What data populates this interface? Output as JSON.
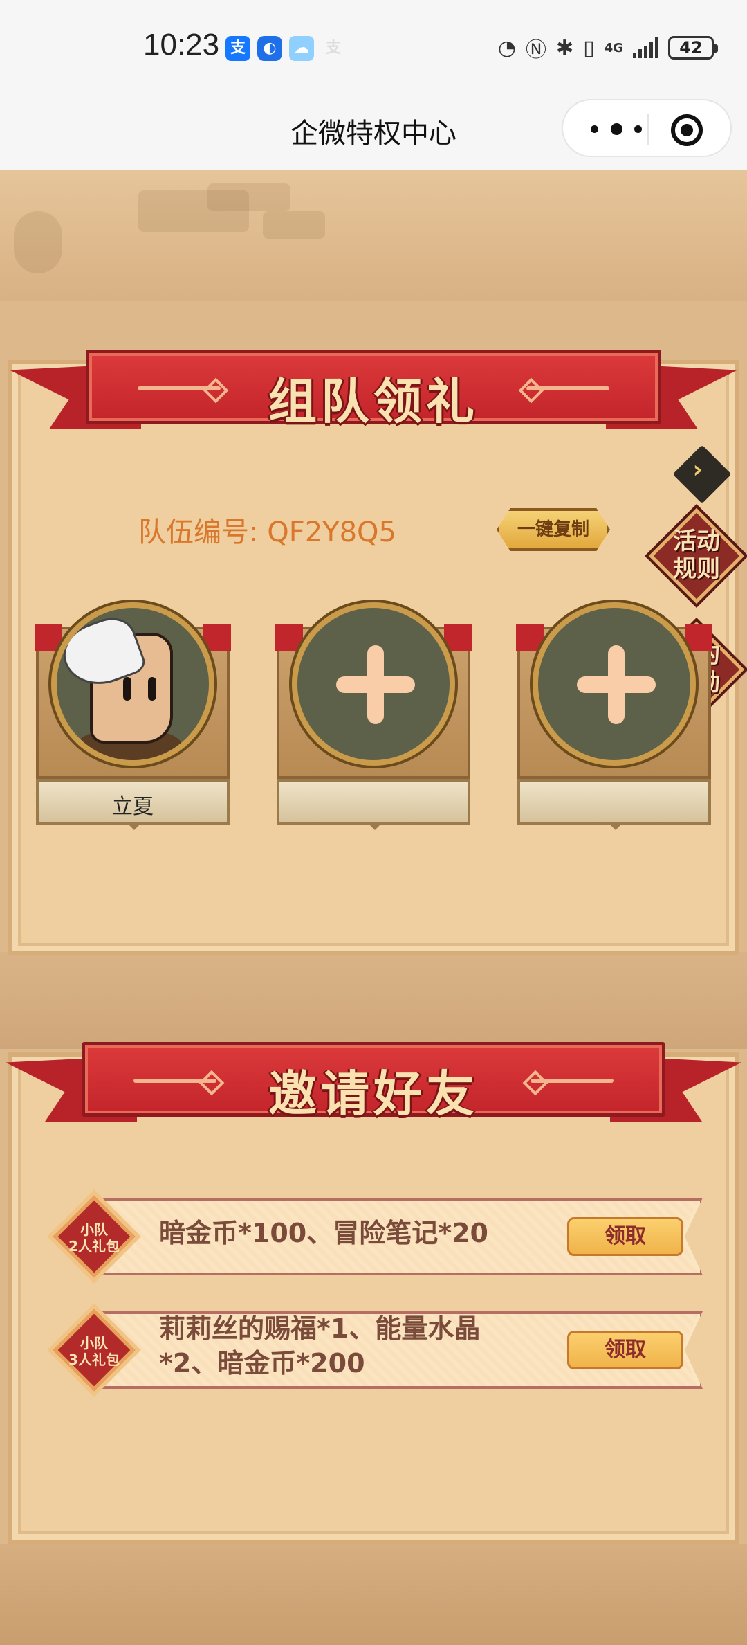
{
  "status_bar": {
    "time": "10:23",
    "network": "4G",
    "battery": "42",
    "app_icons": [
      "alipay-icon",
      "browser-icon",
      "cloud-icon",
      "alipay-faded-icon"
    ]
  },
  "nav": {
    "title": "企微特权中心"
  },
  "team_section": {
    "title": "组队领礼",
    "team_id_label": "队伍编号:",
    "team_id": "QF2Y8Q5",
    "copy_button": "一键复制",
    "rules_button": "活动\n规则",
    "rewards_button": "我的\n奖励",
    "members": [
      {
        "name": "立夏",
        "filled": true
      },
      {
        "name": "",
        "filled": false
      },
      {
        "name": "",
        "filled": false
      }
    ]
  },
  "invite_section": {
    "title": "邀请好友",
    "rewards": [
      {
        "badge_line1": "小队",
        "badge_line2": "2人礼包",
        "desc": "暗金币*100、冒险笔记*20",
        "button": "领取"
      },
      {
        "badge_line1": "小队",
        "badge_line2": "3人礼包",
        "desc": "莉莉丝的赐福*1、能量水晶*2、暗金币*200",
        "button": "领取"
      }
    ]
  },
  "colors": {
    "ribbon_red": "#c3252b",
    "team_id_orange": "#d9782c",
    "claim_yellow": "#f0b34a",
    "slot_green": "#5d6149"
  }
}
